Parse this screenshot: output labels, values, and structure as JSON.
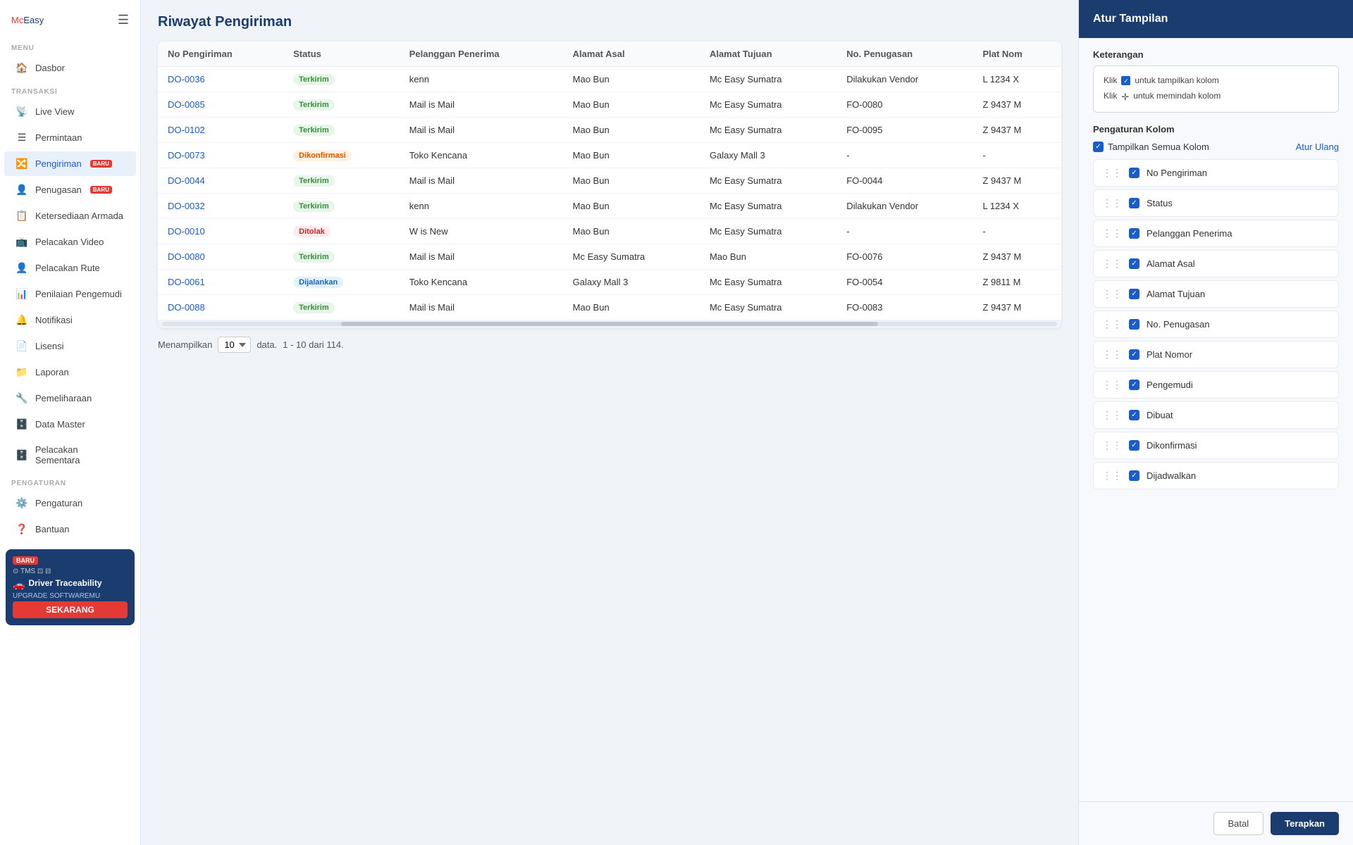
{
  "logo": {
    "mc": "Mc",
    "easy": "Easy"
  },
  "sidebar": {
    "menu_label": "MENU",
    "transaksi_label": "TRANSAKSI",
    "pengaturan_label": "PENGATURAN",
    "items": [
      {
        "id": "dasbor",
        "label": "Dasbor",
        "icon": "🏠",
        "badge": null,
        "active": false
      },
      {
        "id": "live-view",
        "label": "Live View",
        "icon": "📡",
        "badge": null,
        "active": false
      },
      {
        "id": "permintaan",
        "label": "Permintaan",
        "icon": "☰",
        "badge": null,
        "active": false
      },
      {
        "id": "pengiriman",
        "label": "Pengiriman",
        "icon": "🔀",
        "badge": "BARU",
        "active": true
      },
      {
        "id": "penugasan",
        "label": "Penugasan",
        "icon": "👤",
        "badge": "BARU",
        "active": false
      },
      {
        "id": "ketersediaan-armada",
        "label": "Ketersediaan Armada",
        "icon": "📋",
        "badge": null,
        "active": false
      },
      {
        "id": "pelacakan-video",
        "label": "Pelacakan Video",
        "icon": "📺",
        "badge": null,
        "active": false
      },
      {
        "id": "pelacakan-rute",
        "label": "Pelacakan Rute",
        "icon": "👤",
        "badge": null,
        "active": false
      },
      {
        "id": "penilaian-pengemudi",
        "label": "Penilaian Pengemudi",
        "icon": "📊",
        "badge": null,
        "active": false
      },
      {
        "id": "notifikasi",
        "label": "Notifikasi",
        "icon": "🔔",
        "badge": null,
        "active": false
      },
      {
        "id": "lisensi",
        "label": "Lisensi",
        "icon": "📄",
        "badge": null,
        "active": false
      },
      {
        "id": "laporan",
        "label": "Laporan",
        "icon": "📁",
        "badge": null,
        "active": false
      },
      {
        "id": "pemeliharaan",
        "label": "Pemeliharaan",
        "icon": "🔧",
        "badge": null,
        "active": false
      },
      {
        "id": "data-master",
        "label": "Data Master",
        "icon": "🗄️",
        "badge": null,
        "active": false
      },
      {
        "id": "pelacakan-sementara",
        "label": "Pelacakan Sementara",
        "icon": "🗄️",
        "badge": null,
        "active": false
      },
      {
        "id": "pengaturan",
        "label": "Pengaturan",
        "icon": "⚙️",
        "badge": null,
        "active": false
      },
      {
        "id": "bantuan",
        "label": "Bantuan",
        "icon": "❓",
        "badge": null,
        "active": false
      }
    ]
  },
  "promo": {
    "badge": "BARU",
    "icons": "⊙ TMS ⊡ ⊟",
    "driver_label": "Driver Traceability",
    "upgrade_label": "UPGRADE SOFTWAREMU",
    "cta_label": "SEKARANG"
  },
  "page": {
    "title": "Riwayat Pengiriman"
  },
  "table": {
    "columns": [
      "No Pengiriman",
      "Status",
      "Pelanggan Penerima",
      "Alamat Asal",
      "Alamat Tujuan",
      "No. Penugasan",
      "Plat Nom"
    ],
    "rows": [
      {
        "no": "DO-0036",
        "status": "Terkirim",
        "status_class": "status-terkirim",
        "pelanggan": "kenn",
        "asal": "Mao Bun",
        "tujuan": "Mc Easy Sumatra",
        "penugasan": "Dilakukan Vendor",
        "plat": "L 1234 X"
      },
      {
        "no": "DO-0085",
        "status": "Terkirim",
        "status_class": "status-terkirim",
        "pelanggan": "Mail is Mail",
        "asal": "Mao Bun",
        "tujuan": "Mc Easy Sumatra",
        "penugasan": "FO-0080",
        "plat": "Z 9437 M"
      },
      {
        "no": "DO-0102",
        "status": "Terkirim",
        "status_class": "status-terkirim",
        "pelanggan": "Mail is Mail",
        "asal": "Mao Bun",
        "tujuan": "Mc Easy Sumatra",
        "penugasan": "FO-0095",
        "plat": "Z 9437 M"
      },
      {
        "no": "DO-0073",
        "status": "Dikonfirmasi",
        "status_class": "status-dikonfirmasi",
        "pelanggan": "Toko Kencana",
        "asal": "Mao Bun",
        "tujuan": "Galaxy Mall 3",
        "penugasan": "-",
        "plat": "-"
      },
      {
        "no": "DO-0044",
        "status": "Terkirim",
        "status_class": "status-terkirim",
        "pelanggan": "Mail is Mail",
        "asal": "Mao Bun",
        "tujuan": "Mc Easy Sumatra",
        "penugasan": "FO-0044",
        "plat": "Z 9437 M"
      },
      {
        "no": "DO-0032",
        "status": "Terkirim",
        "status_class": "status-terkirim",
        "pelanggan": "kenn",
        "asal": "Mao Bun",
        "tujuan": "Mc Easy Sumatra",
        "penugasan": "Dilakukan Vendor",
        "plat": "L 1234 X"
      },
      {
        "no": "DO-0010",
        "status": "Ditolak",
        "status_class": "status-ditolak",
        "pelanggan": "W is New",
        "asal": "Mao Bun",
        "tujuan": "Mc Easy Sumatra",
        "penugasan": "-",
        "plat": "-"
      },
      {
        "no": "DO-0080",
        "status": "Terkirim",
        "status_class": "status-terkirim",
        "pelanggan": "Mail is Mail",
        "asal": "Mc Easy Sumatra",
        "tujuan": "Mao Bun",
        "penugasan": "FO-0076",
        "plat": "Z 9437 M"
      },
      {
        "no": "DO-0061",
        "status": "Dijalankan",
        "status_class": "status-dijalankan",
        "pelanggan": "Toko Kencana",
        "asal": "Galaxy Mall 3",
        "tujuan": "Mc Easy Sumatra",
        "penugasan": "FO-0054",
        "plat": "Z 9811 M"
      },
      {
        "no": "DO-0088",
        "status": "Terkirim",
        "status_class": "status-terkirim",
        "pelanggan": "Mail is Mail",
        "asal": "Mao Bun",
        "tujuan": "Mc Easy Sumatra",
        "penugasan": "FO-0083",
        "plat": "Z 9437 M"
      }
    ],
    "footer": {
      "menampilkan_label": "Menampilkan",
      "per_page": "10",
      "data_label": "data.",
      "range_label": "1 - 10 dari 114."
    }
  },
  "right_panel": {
    "title": "Atur Tampilan",
    "keterangan_label": "Keterangan",
    "klik_checkbox_text": "untuk tampilkan kolom",
    "klik_move_text": "untuk memindah kolom",
    "pengaturan_kolom_label": "Pengaturan Kolom",
    "tampilkan_semua_label": "Tampilkan Semua Kolom",
    "atur_ulang_label": "Atur Ulang",
    "columns": [
      {
        "id": "no-pengiriman",
        "label": "No Pengiriman",
        "checked": true
      },
      {
        "id": "status",
        "label": "Status",
        "checked": true
      },
      {
        "id": "pelanggan-penerima",
        "label": "Pelanggan Penerima",
        "checked": true
      },
      {
        "id": "alamat-asal",
        "label": "Alamat Asal",
        "checked": true
      },
      {
        "id": "alamat-tujuan",
        "label": "Alamat Tujuan",
        "checked": true
      },
      {
        "id": "no-penugasan",
        "label": "No. Penugasan",
        "checked": true
      },
      {
        "id": "plat-nomor",
        "label": "Plat Nomor",
        "checked": true
      },
      {
        "id": "pengemudi",
        "label": "Pengemudi",
        "checked": true
      },
      {
        "id": "dibuat",
        "label": "Dibuat",
        "checked": true
      },
      {
        "id": "dikonfirmasi",
        "label": "Dikonfirmasi",
        "checked": true
      },
      {
        "id": "dijadwalkan",
        "label": "Dijadwalkan",
        "checked": true
      }
    ],
    "btn_batal": "Batal",
    "btn_terapkan": "Terapkan"
  },
  "colors": {
    "primary_dark": "#1a3c6e",
    "accent_red": "#e53935",
    "accent_blue": "#1a5dc8"
  }
}
